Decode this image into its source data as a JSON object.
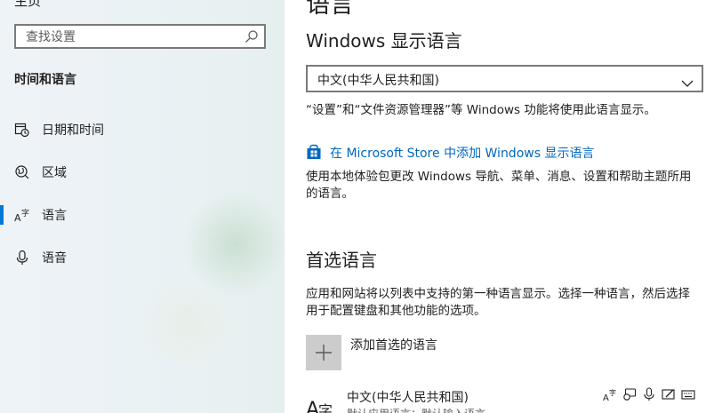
{
  "sidebar": {
    "top_fragment": "主页",
    "search": {
      "placeholder": "查找设置"
    },
    "section_title": "时间和语言",
    "items": [
      {
        "label": "日期和时间",
        "icon": "calendar-clock-icon",
        "active": false
      },
      {
        "label": "区域",
        "icon": "globe-region-icon",
        "active": false
      },
      {
        "label": "语言",
        "icon": "language-icon",
        "active": true
      },
      {
        "label": "语音",
        "icon": "microphone-icon",
        "active": false
      }
    ]
  },
  "main": {
    "page_title": "语言",
    "display_language": {
      "heading": "Windows 显示语言",
      "selected": "中文(中华人民共和国)",
      "note": "“设置”和“文件资源管理器”等 Windows 功能将使用此语言显示。",
      "store_link": "在 Microsoft Store 中添加 Windows 显示语言",
      "store_note_line1": "使用本地体验包更改 Windows 导航、菜单、消息、设置和帮助主题所用",
      "store_note_line2": "的语言。"
    },
    "preferred": {
      "heading": "首选语言",
      "desc_line1": "应用和网站将以列表中支持的第一种语言显示。选择一种语言，然后选择",
      "desc_line2": "用于配置键盘和其他功能的选项。",
      "add_label": "添加首选的语言",
      "languages": [
        {
          "name": "中文(中华人民共和国)",
          "sub": "默认应用语言；默认输入语言",
          "glyph": "A字",
          "feature_icons": [
            "display-language-icon",
            "speech-icon",
            "microphone-icon",
            "handwriting-icon",
            "keyboard-icon"
          ]
        }
      ]
    }
  },
  "colors": {
    "accent": "#0078d7",
    "link": "#0067c0",
    "sidebar_bg": "#eef3f8"
  }
}
